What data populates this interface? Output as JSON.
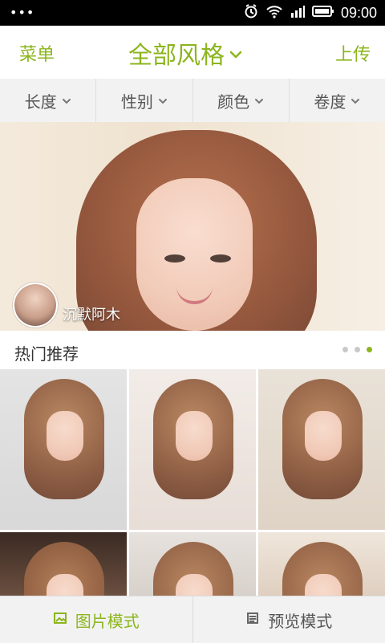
{
  "statusbar": {
    "time": "09:00"
  },
  "topbar": {
    "left": "菜单",
    "title": "全部风格",
    "right": "上传"
  },
  "filters": {
    "items": [
      "长度",
      "性别",
      "颜色",
      "卷度"
    ]
  },
  "hero": {
    "author_name": "沉默阿木"
  },
  "section": {
    "title": "热门推荐"
  },
  "bottombar": {
    "picture_mode": "图片模式",
    "preview_mode": "预览模式"
  },
  "colors": {
    "accent": "#8cb51e"
  },
  "icons": {
    "status": [
      "more-icon",
      "alarm-icon",
      "wifi-icon",
      "signal-icon",
      "battery-icon"
    ],
    "dropdown": "chevron-down-icon",
    "picture_mode": "image-icon",
    "preview_mode": "list-icon"
  }
}
